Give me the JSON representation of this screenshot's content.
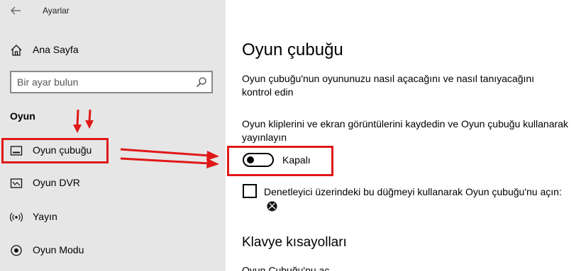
{
  "window": {
    "title": "Ayarlar"
  },
  "sidebar": {
    "home_label": "Ana Sayfa",
    "search_placeholder": "Bir ayar bulun",
    "section_heading": "Oyun",
    "items": [
      {
        "label": "Oyun çubuğu",
        "icon": "game-bar-icon"
      },
      {
        "label": "Oyun DVR",
        "icon": "dvr-icon"
      },
      {
        "label": "Yayın",
        "icon": "broadcast-icon"
      },
      {
        "label": "Oyun Modu",
        "icon": "game-mode-icon"
      }
    ]
  },
  "main": {
    "title": "Oyun çubuğu",
    "description": "Oyun çubuğu'nun oyununuzu nasıl açacağını ve nasıl tanıyacağını kontrol edin",
    "record_description": "Oyun kliplerini ve ekran görüntülerini kaydedin ve Oyun çubuğu kullanarak yayınlayın",
    "toggle": {
      "state_label": "Kapalı",
      "on": false
    },
    "checkbox": {
      "label": "Denetleyici üzerindeki bu düğmeyi kullanarak Oyun çubuğu'nu açın:",
      "checked": false,
      "icon": "xbox-icon"
    },
    "shortcuts_heading": "Klavye kısayolları",
    "shortcuts_first_item": "Oyun Çubuğu'nu aç"
  },
  "annotations": {
    "highlight_color": "#e01818"
  }
}
